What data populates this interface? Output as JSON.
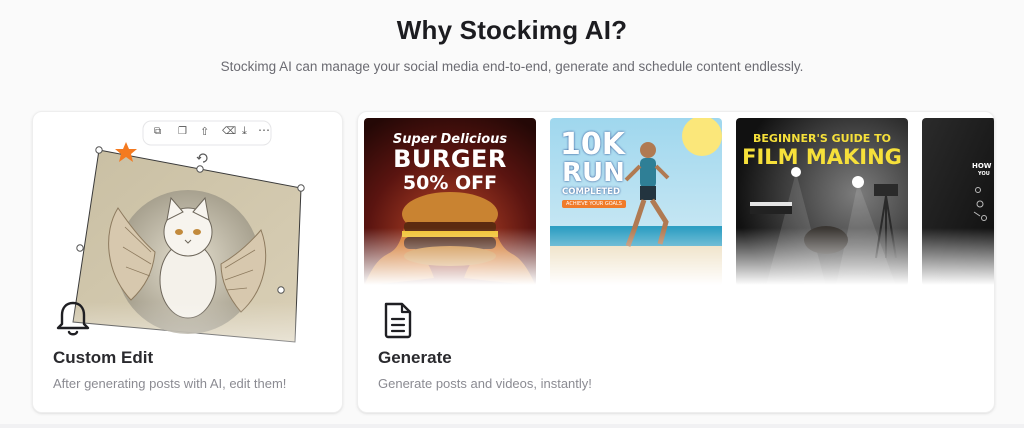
{
  "section": {
    "title": "Why Stockimg AI?",
    "subtitle": "Stockimg AI can manage your social media end-to-end, generate and schedule content endlessly."
  },
  "cards": {
    "edit": {
      "icon": "bell-icon",
      "title": "Custom Edit",
      "description": "After generating posts with AI, edit them!"
    },
    "generate": {
      "icon": "document-icon",
      "title": "Generate",
      "description": "Generate posts and videos, instantly!"
    }
  },
  "thumbnails": [
    {
      "name": "burger-post",
      "line1": "Super Delicious",
      "line2": "BURGER",
      "line3": "50% OFF"
    },
    {
      "name": "run-post",
      "line1": "10K",
      "line2": "RUN",
      "line3": "COMPLETED",
      "line4": "ACHIEVE YOUR GOALS"
    },
    {
      "name": "film-post",
      "line1": "BEGINNER'S GUIDE TO",
      "line2": "FILM MAKING"
    },
    {
      "name": "howto-post",
      "line1": "HOW",
      "line2": "YOU"
    }
  ],
  "colors": {
    "accent_star": "#f47a20",
    "film_yellow": "#f6e03a",
    "run_blue": "#1e3f86"
  }
}
